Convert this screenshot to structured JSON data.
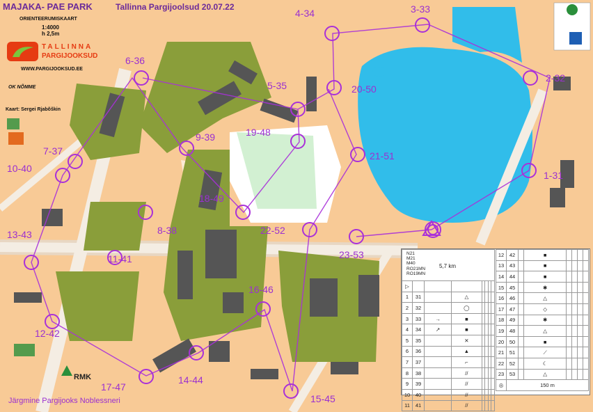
{
  "header": {
    "title": "MAJAKA- PAE PARK",
    "event": "Tallinna Pargijoolsud 20.07.22",
    "map_type": "ORIENTEERUMISKAART",
    "scale": "1:4000",
    "contour": "h 2,5m",
    "club": "TALLINNA",
    "club2": "PARGIJOOKSUD",
    "website": "WWW.PARGIJOOKSUD.EE",
    "cartographer": "Kaart: Sergei Rjabõškin",
    "ok_logo": "OK NÕMME",
    "rmk": "RMK",
    "footer": "Järgmine Pargijooks Noblessneri"
  },
  "controls": [
    {
      "label": "3-33"
    },
    {
      "label": "4-34"
    },
    {
      "label": "6-36"
    },
    {
      "label": "5-35"
    },
    {
      "label": "20-50"
    },
    {
      "label": "2-32"
    },
    {
      "label": "9-39"
    },
    {
      "label": "19-48"
    },
    {
      "label": "21-51"
    },
    {
      "label": "7-37"
    },
    {
      "label": "10-40"
    },
    {
      "label": "1-31"
    },
    {
      "label": "18-49"
    },
    {
      "label": "8-38"
    },
    {
      "label": "22-52"
    },
    {
      "label": "13-43"
    },
    {
      "label": "23-53"
    },
    {
      "label": "11-41"
    },
    {
      "label": "16-46"
    },
    {
      "label": "12-42"
    },
    {
      "label": "14-44"
    },
    {
      "label": "17-47"
    },
    {
      "label": "15-45"
    }
  ],
  "control_description": {
    "classes": [
      "N21",
      "M21",
      "M40",
      "RO21MN",
      "RO19MN"
    ],
    "length": "5,7 km",
    "left_rows": [
      {
        "n": "1",
        "code": "31"
      },
      {
        "n": "2",
        "code": "32"
      },
      {
        "n": "3",
        "code": "33"
      },
      {
        "n": "4",
        "code": "34"
      },
      {
        "n": "5",
        "code": "35"
      },
      {
        "n": "6",
        "code": "36"
      },
      {
        "n": "7",
        "code": "37"
      },
      {
        "n": "8",
        "code": "38"
      },
      {
        "n": "9",
        "code": "39"
      },
      {
        "n": "10",
        "code": "40"
      },
      {
        "n": "11",
        "code": "41"
      }
    ],
    "right_rows": [
      {
        "n": "12",
        "code": "42"
      },
      {
        "n": "13",
        "code": "43"
      },
      {
        "n": "14",
        "code": "44"
      },
      {
        "n": "15",
        "code": "45"
      },
      {
        "n": "16",
        "code": "46"
      },
      {
        "n": "17",
        "code": "47"
      },
      {
        "n": "18",
        "code": "49"
      },
      {
        "n": "19",
        "code": "48"
      },
      {
        "n": "20",
        "code": "50"
      },
      {
        "n": "21",
        "code": "51"
      },
      {
        "n": "22",
        "code": "52"
      },
      {
        "n": "23",
        "code": "53"
      }
    ],
    "finish": "150 m"
  }
}
